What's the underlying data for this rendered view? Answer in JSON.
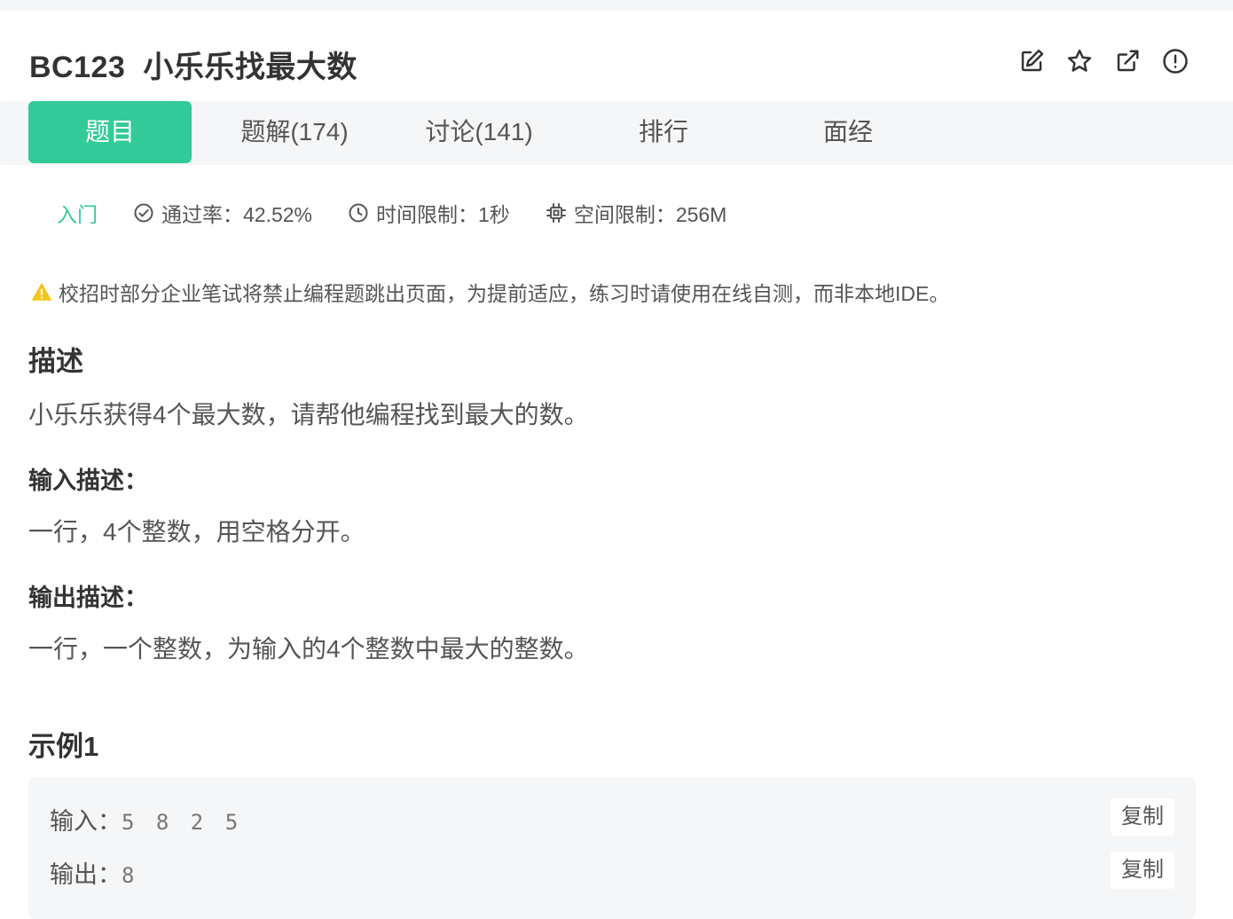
{
  "problem": {
    "code": "BC123",
    "title": "小乐乐找最大数"
  },
  "header_icons": [
    "edit-icon",
    "star-icon",
    "share-icon",
    "report-icon"
  ],
  "tabs": [
    {
      "label": "题目",
      "active": true
    },
    {
      "label": "题解(174)",
      "active": false
    },
    {
      "label": "讨论(141)",
      "active": false
    },
    {
      "label": "排行",
      "active": false
    },
    {
      "label": "面经",
      "active": false
    }
  ],
  "meta": {
    "level": "入门",
    "pass_rate": "通过率：42.52%",
    "time_limit": "时间限制：1秒",
    "space_limit": "空间限制：256M"
  },
  "warning": "校招时部分企业笔试将禁止编程题跳出页面，为提前适应，练习时请使用在线自测，而非本地IDE。",
  "description": {
    "heading": "描述",
    "text": "小乐乐获得4个最大数，请帮他编程找到最大的数。"
  },
  "input_desc": {
    "heading": "输入描述：",
    "text": "一行，4个整数，用空格分开。"
  },
  "output_desc": {
    "heading": "输出描述：",
    "text": "一行，一个整数，为输入的4个整数中最大的整数。"
  },
  "example": {
    "heading": "示例1",
    "input_label": "输入：",
    "input_value": "5 8 2 5",
    "output_label": "输出：",
    "output_value": "8",
    "copy_label": "复制"
  },
  "colors": {
    "accent": "#32ca99",
    "warning": "#f5c518",
    "tab_bg": "#f5f6f8",
    "text": "#333333"
  }
}
